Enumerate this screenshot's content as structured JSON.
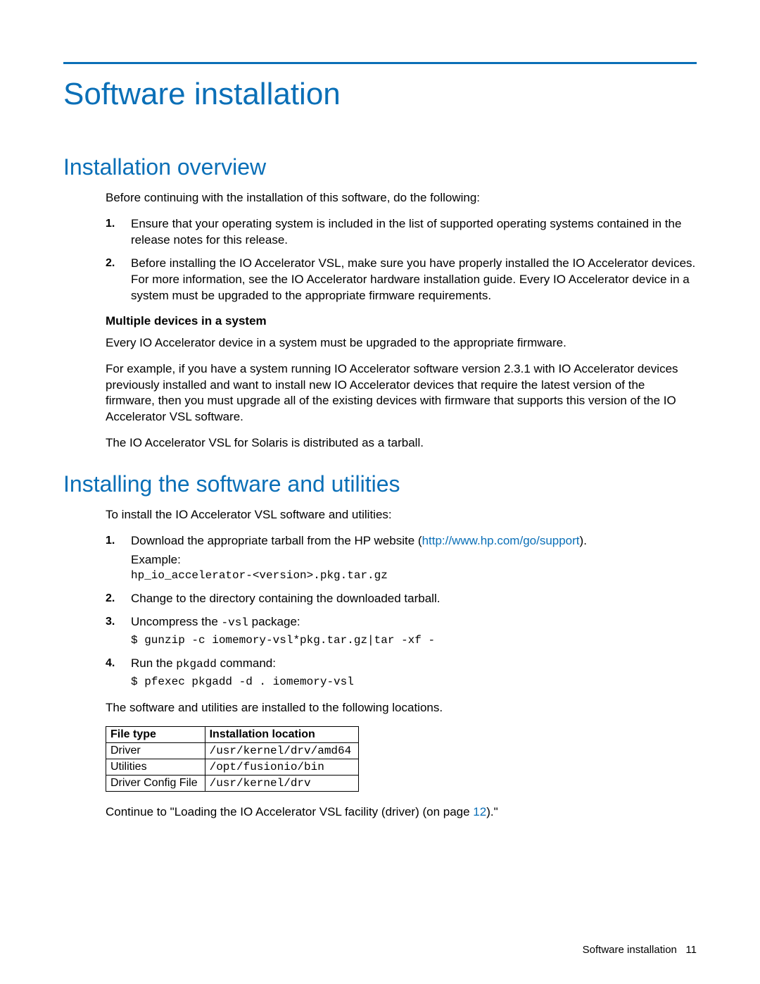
{
  "title": "Software installation",
  "sec1": {
    "heading": "Installation overview",
    "intro": "Before continuing with the installation of this software, do the following:",
    "steps": [
      {
        "num": "1.",
        "text": "Ensure that your operating system is included in the list of supported operating systems contained in the release notes for this release."
      },
      {
        "num": "2.",
        "text": "Before installing the IO Accelerator VSL, make sure you have properly installed the IO Accelerator devices. For more information, see the IO Accelerator hardware installation guide. Every IO Accelerator device in a system must be upgraded to the appropriate firmware requirements."
      }
    ],
    "sub_heading": "Multiple devices in a system",
    "para1": "Every IO Accelerator device in a system must be upgraded to the appropriate firmware.",
    "para2": "For example, if you have a system running IO Accelerator software version 2.3.1 with IO Accelerator devices previously installed and want to install new IO Accelerator devices that require the latest version of the firmware, then you must upgrade all of the existing devices with firmware that supports this version of the IO Accelerator VSL software.",
    "para3": "The IO Accelerator VSL for Solaris is distributed as a tarball."
  },
  "sec2": {
    "heading": "Installing the software and utilities",
    "intro": "To install the IO Accelerator VSL software and utilities:",
    "step1": {
      "num": "1.",
      "pre": "Download the appropriate tarball from the HP website (",
      "link": "http://www.hp.com/go/support",
      "post": ").",
      "example_label": "Example:",
      "example_code": "hp_io_accelerator-<version>.pkg.tar.gz"
    },
    "step2": {
      "num": "2.",
      "text": "Change to the directory containing the downloaded tarball."
    },
    "step3": {
      "num": "3.",
      "pre": "Uncompress the ",
      "code_inline": "-vsl",
      "post": " package:",
      "cmd": "$ gunzip -c iomemory-vsl*pkg.tar.gz|tar -xf -"
    },
    "step4": {
      "num": "4.",
      "pre": "Run the ",
      "code_inline": "pkgadd",
      "post": " command:",
      "cmd": "$ pfexec pkgadd -d . iomemory-vsl"
    },
    "after_steps": "The software and utilities are installed to the following locations.",
    "table": {
      "headers": [
        "File type",
        "Installation location"
      ],
      "rows": [
        [
          "Driver",
          "/usr/kernel/drv/amd64"
        ],
        [
          "Utilities",
          "/opt/fusionio/bin"
        ],
        [
          "Driver Config File",
          "/usr/kernel/drv"
        ]
      ]
    },
    "continue_pre": "Continue to \"Loading the IO Accelerator VSL facility (driver) (on page ",
    "continue_page": "12",
    "continue_post": ").\""
  },
  "footer": {
    "label": "Software installation",
    "page": "11"
  }
}
